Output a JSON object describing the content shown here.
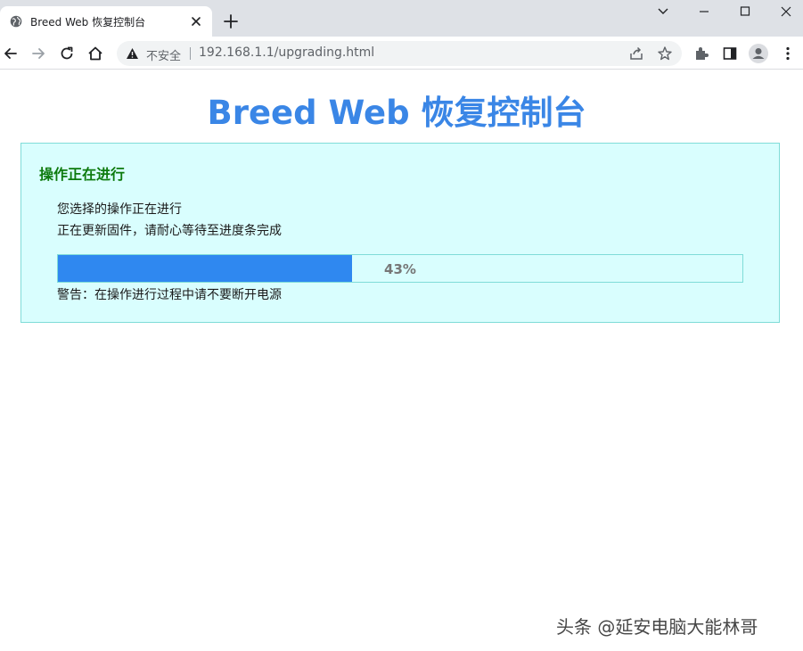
{
  "browser": {
    "tab": {
      "title": "Breed Web 恢复控制台"
    },
    "address": {
      "security_label": "不安全",
      "url": "192.168.1.1/upgrading.html"
    }
  },
  "page": {
    "title": "Breed Web 恢复控制台",
    "panel": {
      "heading": "操作正在进行",
      "line1": "您选择的操作正在进行",
      "line2": "正在更新固件，请耐心等待至进度条完成",
      "progress": {
        "percent": 43,
        "label": "43%"
      },
      "warning": "警告：在操作进行过程中请不要断开电源"
    }
  },
  "watermark": "头条 @延安电脑大能林哥",
  "colors": {
    "title": "#3a86e6",
    "panel_bg": "#d9fefe",
    "panel_border": "#7fdcd8",
    "heading": "#0d7a0d",
    "progress_fill": "#2f88f0"
  }
}
